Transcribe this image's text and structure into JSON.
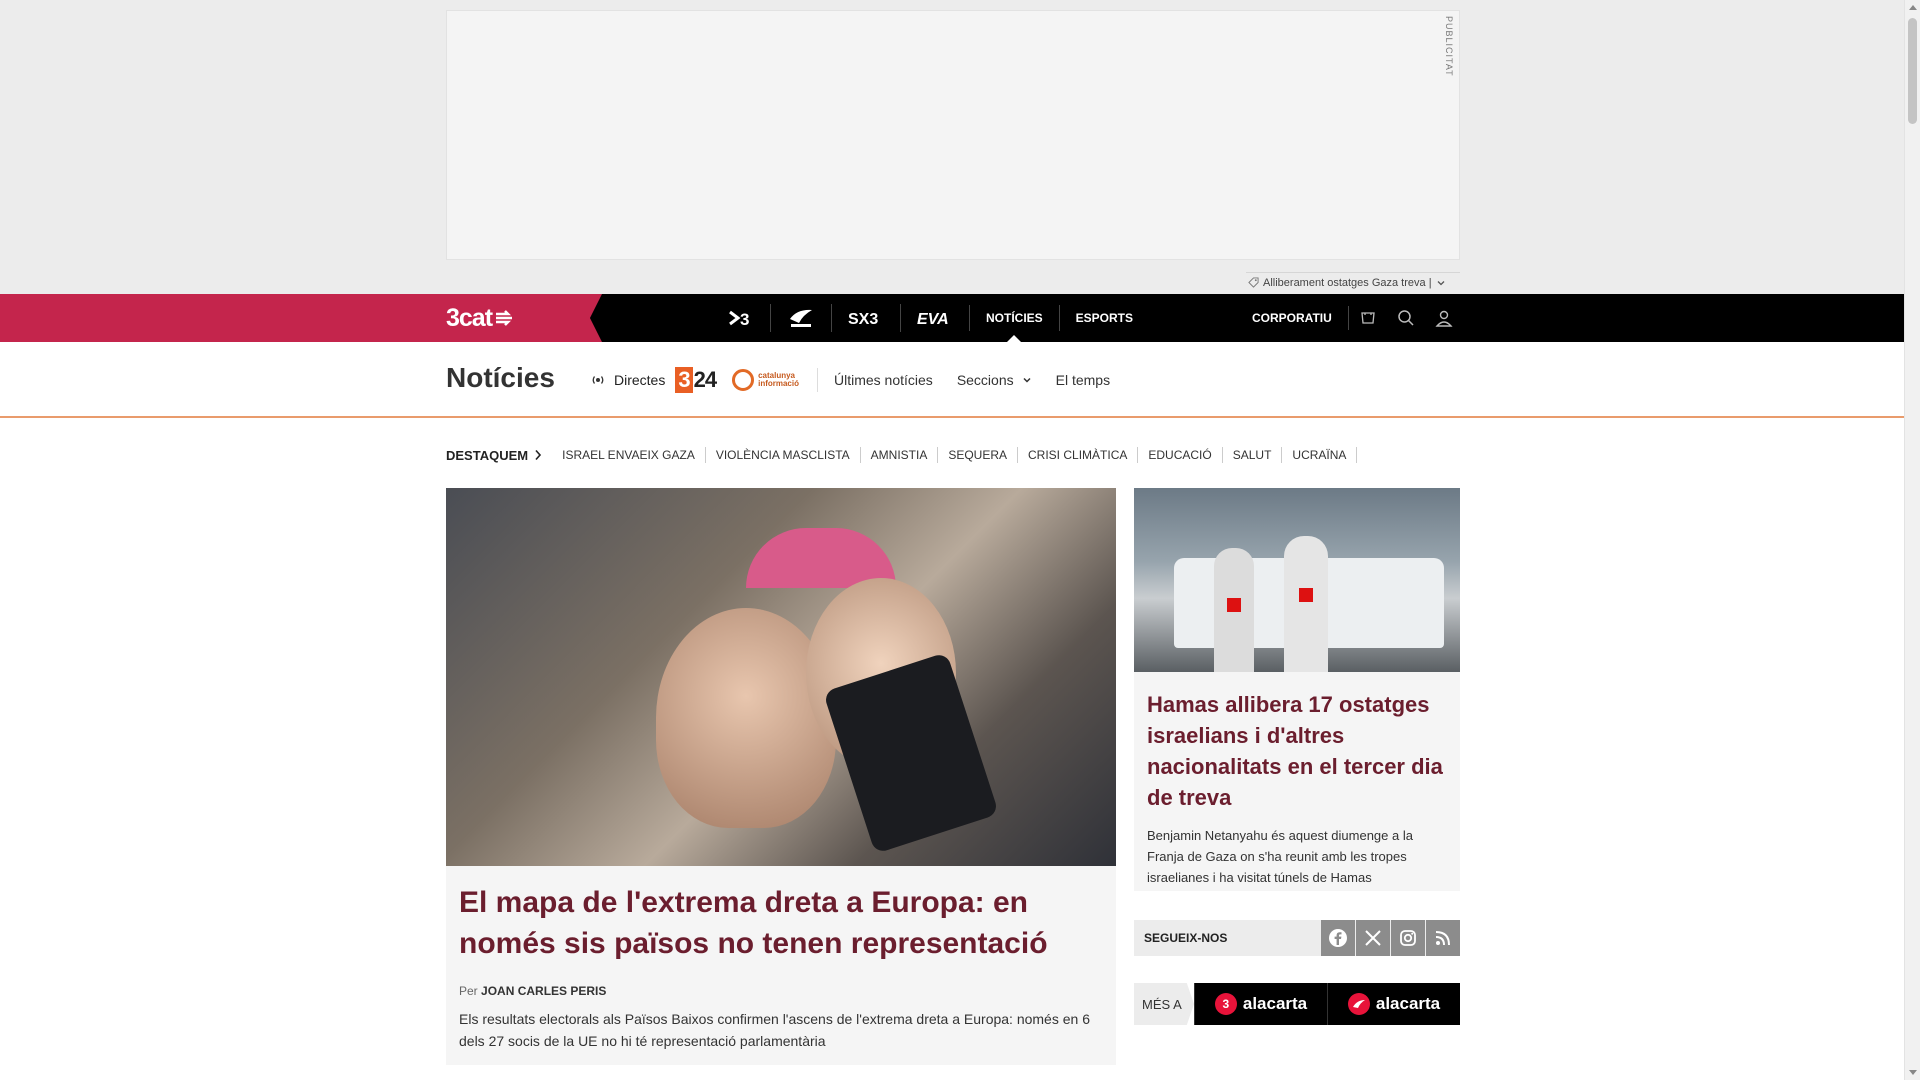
{
  "ad": {
    "label": "PUBLICITAT",
    "tag_text": "Alliberament ostatges Gaza treva |"
  },
  "topnav": {
    "logo": "3cat",
    "channels": [
      "3",
      "Cat Ràdio",
      "SX3",
      "EVA"
    ],
    "channel_icons": [
      "tv3-icon",
      "catradio-icon",
      "sx3-icon",
      "eva-icon"
    ],
    "links": [
      "NOTÍCIES",
      "ESPORTS"
    ],
    "active_link": "NOTÍCIES",
    "corporate": "CORPORATIU",
    "tools": [
      "cart-icon",
      "search-icon",
      "user-icon"
    ]
  },
  "section": {
    "title": "Notícies",
    "directes": "Directes",
    "logo324": "24",
    "logo324_three": "3",
    "catinfo": [
      "catalunya",
      "informació"
    ],
    "links": [
      "Últimes notícies",
      "Seccions",
      "El temps"
    ]
  },
  "destaquem": {
    "title": "DESTAQUEM",
    "tags": [
      "ISRAEL ENVAEIX GAZA",
      "VIOLÈNCIA MASCLISTA",
      "AMNISTIA",
      "SEQUERA",
      "CRISI CLIMÀTICA",
      "EDUCACIÓ",
      "SALUT",
      "UCRAÏNA"
    ]
  },
  "main_article": {
    "headline": "El mapa de l'extrema dreta a Europa: en només sis països no tenen representació",
    "byline_prefix": "Per",
    "author": "JOAN CARLES PERIS",
    "lead": "Els resultats electorals als Països Baixos confirmen l'ascens de l'extrema dreta a Europa: només en 6 dels 27 socis de la UE no hi té representació parlamentària"
  },
  "side_article": {
    "headline": "Hamas allibera 17 ostatges israelians i d'altres nacionalitats en el tercer dia de treva",
    "lead": "Benjamin Netanyahu és aquest diumenge a la Franja de Gaza on s'ha reunit amb les tropes israelianes i ha visitat túnels de Hamas"
  },
  "follow": {
    "label": "SEGUEIX-NOS",
    "networks": [
      "facebook-icon",
      "x-icon",
      "instagram-icon",
      "rss-icon"
    ]
  },
  "mesa": {
    "label": "MÉS A",
    "items": [
      {
        "badge": "3",
        "text": "alacarta"
      },
      {
        "badge": "",
        "text": "alacarta"
      }
    ]
  },
  "colors": {
    "brand_red": "#c4254c",
    "headline": "#6b1e2e",
    "accent_line": "#e99b6c"
  }
}
